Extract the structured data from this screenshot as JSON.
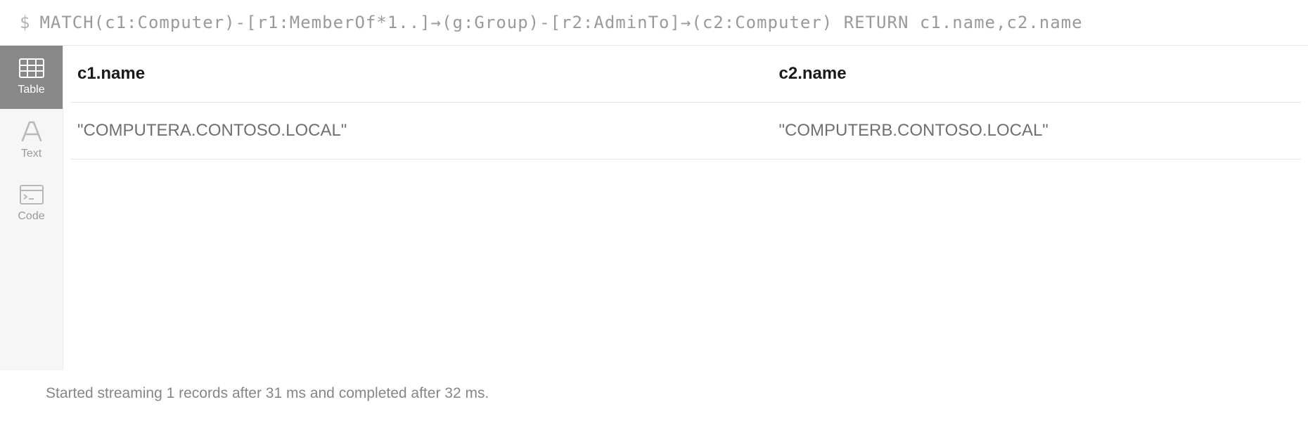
{
  "query": {
    "prompt": "$",
    "text": "MATCH(c1:Computer)-[r1:MemberOf*1..]→(g:Group)-[r2:AdminTo]→(c2:Computer) RETURN c1.name,c2.name"
  },
  "sidebar": {
    "tabs": [
      {
        "label": "Table",
        "active": true
      },
      {
        "label": "Text",
        "active": false
      },
      {
        "label": "Code",
        "active": false
      }
    ]
  },
  "table": {
    "headers": [
      "c1.name",
      "c2.name"
    ],
    "rows": [
      [
        "\"COMPUTERA.CONTOSO.LOCAL\"",
        "\"COMPUTERB.CONTOSO.LOCAL\""
      ]
    ]
  },
  "footer": {
    "status": "Started streaming 1 records after 31 ms and completed after 32 ms."
  }
}
